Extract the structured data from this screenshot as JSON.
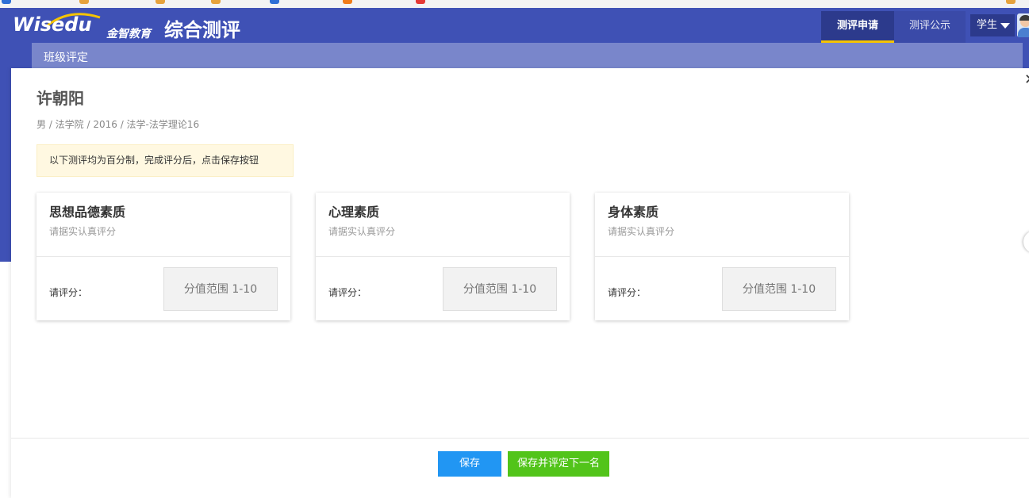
{
  "header": {
    "logo_text": "Wisedu",
    "logo_cn": "金智教育",
    "app_title": "综合测评",
    "tabs": [
      {
        "label": "测评申请",
        "active": true
      },
      {
        "label": "测评公示",
        "active": false
      }
    ],
    "role": "学生"
  },
  "subbar": {
    "title": "班级评定"
  },
  "student": {
    "name": "许朝阳",
    "meta": "男 / 法学院 / 2016 / 法学-法学理论16"
  },
  "notice": "以下测评均为百分制，完成评分后，点击保存按钮",
  "cards": [
    {
      "title": "思想品德素质",
      "subtitle": "请据实认真评分",
      "score_label": "请评分：",
      "placeholder": "分值范围 1-10"
    },
    {
      "title": "心理素质",
      "subtitle": "请据实认真评分",
      "score_label": "请评分：",
      "placeholder": "分值范围 1-10"
    },
    {
      "title": "身体素质",
      "subtitle": "请据实认真评分",
      "score_label": "请评分：",
      "placeholder": "分值范围 1-10"
    }
  ],
  "buttons": {
    "save": "保存",
    "save_next": "保存并评定下一名"
  },
  "icons": {
    "close": "close-icon",
    "role_caret": "caret-down-icon",
    "avatar": "user-avatar-icon"
  },
  "colors": {
    "header_bg": "#3f51b5",
    "subbar_bg": "#7986cb",
    "active_tab_underline": "#f5c400",
    "save_button": "#2196f3",
    "save_next_button": "#52c41a",
    "notice_bg": "#fff8e1"
  }
}
